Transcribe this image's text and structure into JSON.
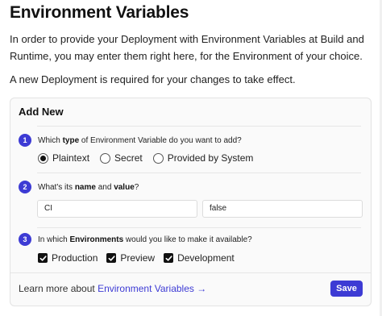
{
  "page": {
    "title": "Environment Variables",
    "intro": "In order to provide your Deployment with Environment Variables at Build and Runtime, you may enter them right here, for the Environment of your choice.",
    "notice": "A new Deployment is required for your changes to take effect."
  },
  "form": {
    "heading": "Add New",
    "step1": {
      "number": "1",
      "question_pre": "Which ",
      "question_bold": "type",
      "question_post": " of Environment Variable do you want to add?",
      "options": [
        {
          "label": "Plaintext",
          "selected": true
        },
        {
          "label": "Secret",
          "selected": false
        },
        {
          "label": "Provided by System",
          "selected": false
        }
      ]
    },
    "step2": {
      "number": "2",
      "question_pre": "What's its ",
      "question_bold1": "name",
      "question_mid": " and ",
      "question_bold2": "value",
      "question_post": "?",
      "name_value": "CI",
      "value_value": "false"
    },
    "step3": {
      "number": "3",
      "question_pre": "In which ",
      "question_bold": "Environments",
      "question_post": " would you like to make it available?",
      "environments": [
        {
          "label": "Production",
          "checked": true
        },
        {
          "label": "Preview",
          "checked": true
        },
        {
          "label": "Development",
          "checked": true
        }
      ]
    },
    "learn_more_prefix": "Learn more about ",
    "learn_more_link": "Environment Variables →",
    "save_label": "Save"
  },
  "colors": {
    "accent": "#3d3bd4",
    "card_bg": "#fafafa"
  }
}
